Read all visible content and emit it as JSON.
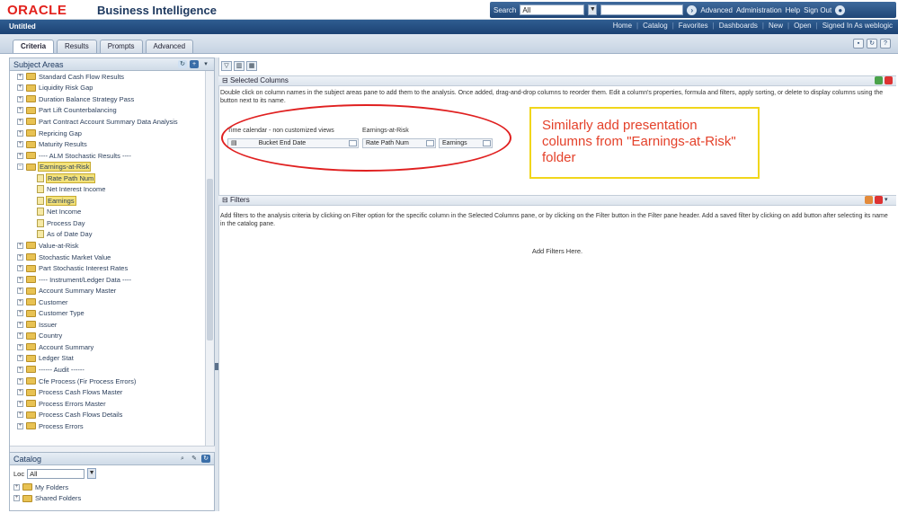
{
  "header": {
    "logo": "ORACLE",
    "product": "Business Intelligence",
    "search_label": "Search",
    "search_scope": "All",
    "links": [
      "Advanced",
      "Administration",
      "Help",
      "Sign Out"
    ]
  },
  "navbar": {
    "document_title": "Untitled",
    "links": [
      "Home",
      "Catalog",
      "Favorites",
      "Dashboards",
      "New",
      "Open",
      "Signed In As  weblogic"
    ]
  },
  "tabs": [
    {
      "label": "Criteria",
      "active": true
    },
    {
      "label": "Results",
      "active": false
    },
    {
      "label": "Prompts",
      "active": false
    },
    {
      "label": "Advanced",
      "active": false
    }
  ],
  "subject_areas": {
    "title": "Subject Areas",
    "items": [
      {
        "label": "Standard Cash Flow Results",
        "kind": "folder",
        "indent": 1
      },
      {
        "label": "Liquidity Risk Gap",
        "kind": "folder",
        "indent": 1
      },
      {
        "label": "Duration Balance Strategy Pass",
        "kind": "folder",
        "indent": 1
      },
      {
        "label": "Part Lift Counterbalancing",
        "kind": "folder",
        "indent": 1
      },
      {
        "label": "Part Contract Account Summary Data Analysis",
        "kind": "folder",
        "indent": 1
      },
      {
        "label": "Repricing Gap",
        "kind": "folder",
        "indent": 1
      },
      {
        "label": "Maturity Results",
        "kind": "folder",
        "indent": 1
      },
      {
        "label": "---- ALM Stochastic Results ----",
        "kind": "folder",
        "indent": 1
      },
      {
        "label": "Earnings-at-Risk",
        "kind": "folder",
        "indent": 1,
        "selected": true
      },
      {
        "label": "Rate Path Num",
        "kind": "column",
        "indent": 2,
        "selected": true
      },
      {
        "label": "Net Interest Income",
        "kind": "column",
        "indent": 2
      },
      {
        "label": "Earnings",
        "kind": "column",
        "indent": 2,
        "selected": true
      },
      {
        "label": "Net Income",
        "kind": "column",
        "indent": 2
      },
      {
        "label": "Process Day",
        "kind": "column",
        "indent": 2
      },
      {
        "label": "As of Date Day",
        "kind": "column",
        "indent": 2
      },
      {
        "label": "Value-at-Risk",
        "kind": "folder",
        "indent": 1
      },
      {
        "label": "Stochastic Market Value",
        "kind": "folder",
        "indent": 1
      },
      {
        "label": "Part Stochastic Interest Rates",
        "kind": "folder",
        "indent": 1
      },
      {
        "label": "---- Instrument/Ledger Data ----",
        "kind": "folder",
        "indent": 1
      },
      {
        "label": "Account Summary Master",
        "kind": "folder",
        "indent": 1
      },
      {
        "label": "Customer",
        "kind": "folder",
        "indent": 1
      },
      {
        "label": "Customer Type",
        "kind": "folder",
        "indent": 1
      },
      {
        "label": "Issuer",
        "kind": "folder",
        "indent": 1
      },
      {
        "label": "Country",
        "kind": "folder",
        "indent": 1
      },
      {
        "label": "Account Summary",
        "kind": "folder",
        "indent": 1
      },
      {
        "label": "Ledger Stat",
        "kind": "folder",
        "indent": 1
      },
      {
        "label": "------ Audit ------",
        "kind": "folder",
        "indent": 1
      },
      {
        "label": "Cfe Process (Fir Process Errors)",
        "kind": "folder",
        "indent": 1
      },
      {
        "label": "Process Cash Flows Master",
        "kind": "folder",
        "indent": 1
      },
      {
        "label": "Process Errors Master",
        "kind": "folder",
        "indent": 1
      },
      {
        "label": "Process Cash Flows Details",
        "kind": "folder",
        "indent": 1
      },
      {
        "label": "Process Errors",
        "kind": "folder",
        "indent": 1
      }
    ]
  },
  "catalog": {
    "title": "Catalog",
    "location_label": "Loc",
    "location_value": "All",
    "items": [
      "My Folders",
      "Shared Folders"
    ]
  },
  "selected_columns": {
    "title": "Selected Columns",
    "instructions": "Double click on column names in the subject areas pane to add them to the analysis. Once added, drag-and-drop columns to reorder them. Edit a column's properties, formula and filters, apply sorting, or delete to display columns using the button next to its name.",
    "groups": [
      {
        "folder": "Time calendar - non customized views",
        "columns": [
          "Bucket End Date"
        ]
      },
      {
        "folder": "Earnings-at-Risk",
        "columns": [
          "Rate Path Num",
          "Earnings"
        ]
      }
    ]
  },
  "callout": {
    "text": "Similarly add presentation columns from \"Earnings-at-Risk\" folder"
  },
  "filters": {
    "title": "Filters",
    "instructions": "Add filters to the analysis criteria by clicking on Filter option for the specific column in the Selected Columns pane, or by clicking on the Filter button in the Filter pane header. Add a saved filter by clicking on add button after selecting its name in the catalog pane.",
    "empty_text": "Add Filters Here."
  },
  "colors": {
    "accent_navy": "#1f4677",
    "oracle_red": "#e2211c",
    "annotation_red": "#e02020",
    "callout_border": "#f1d61b",
    "callout_text": "#e4412a"
  }
}
